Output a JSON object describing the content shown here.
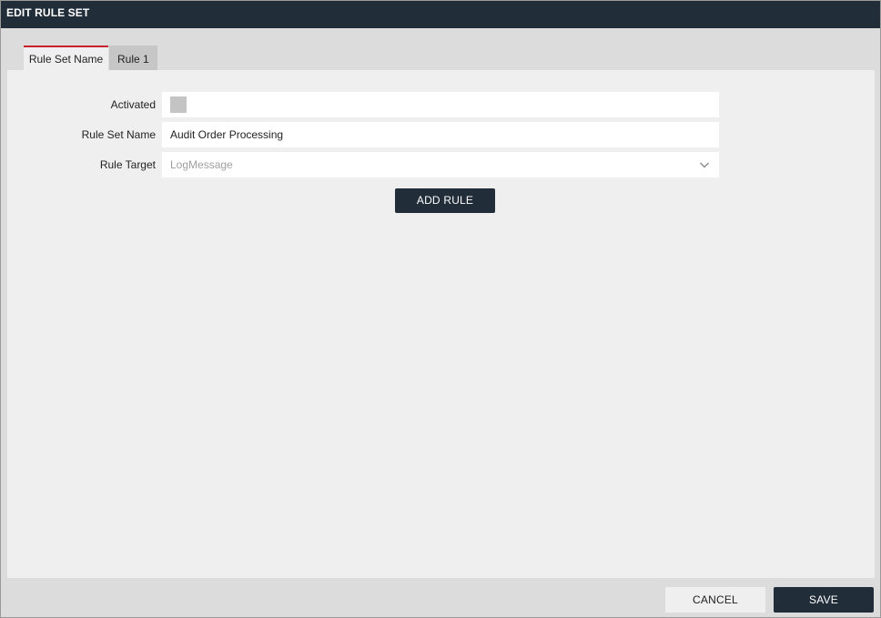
{
  "window": {
    "title": "EDIT RULE SET"
  },
  "tabs": [
    {
      "label": "Rule Set Name",
      "active": true
    },
    {
      "label": "Rule 1",
      "active": false
    }
  ],
  "form": {
    "activated": {
      "label": "Activated",
      "checked": false
    },
    "rule_set_name": {
      "label": "Rule Set Name",
      "value": "Audit Order Processing"
    },
    "rule_target": {
      "label": "Rule Target",
      "value": "LogMessage",
      "icon": "chevron-down-icon"
    }
  },
  "buttons": {
    "add_rule": "ADD RULE",
    "cancel": "CANCEL",
    "save": "SAVE"
  },
  "colors": {
    "titlebar": "#222d3a",
    "accent_tab": "#c8202f",
    "primary_button": "#222d3a"
  }
}
